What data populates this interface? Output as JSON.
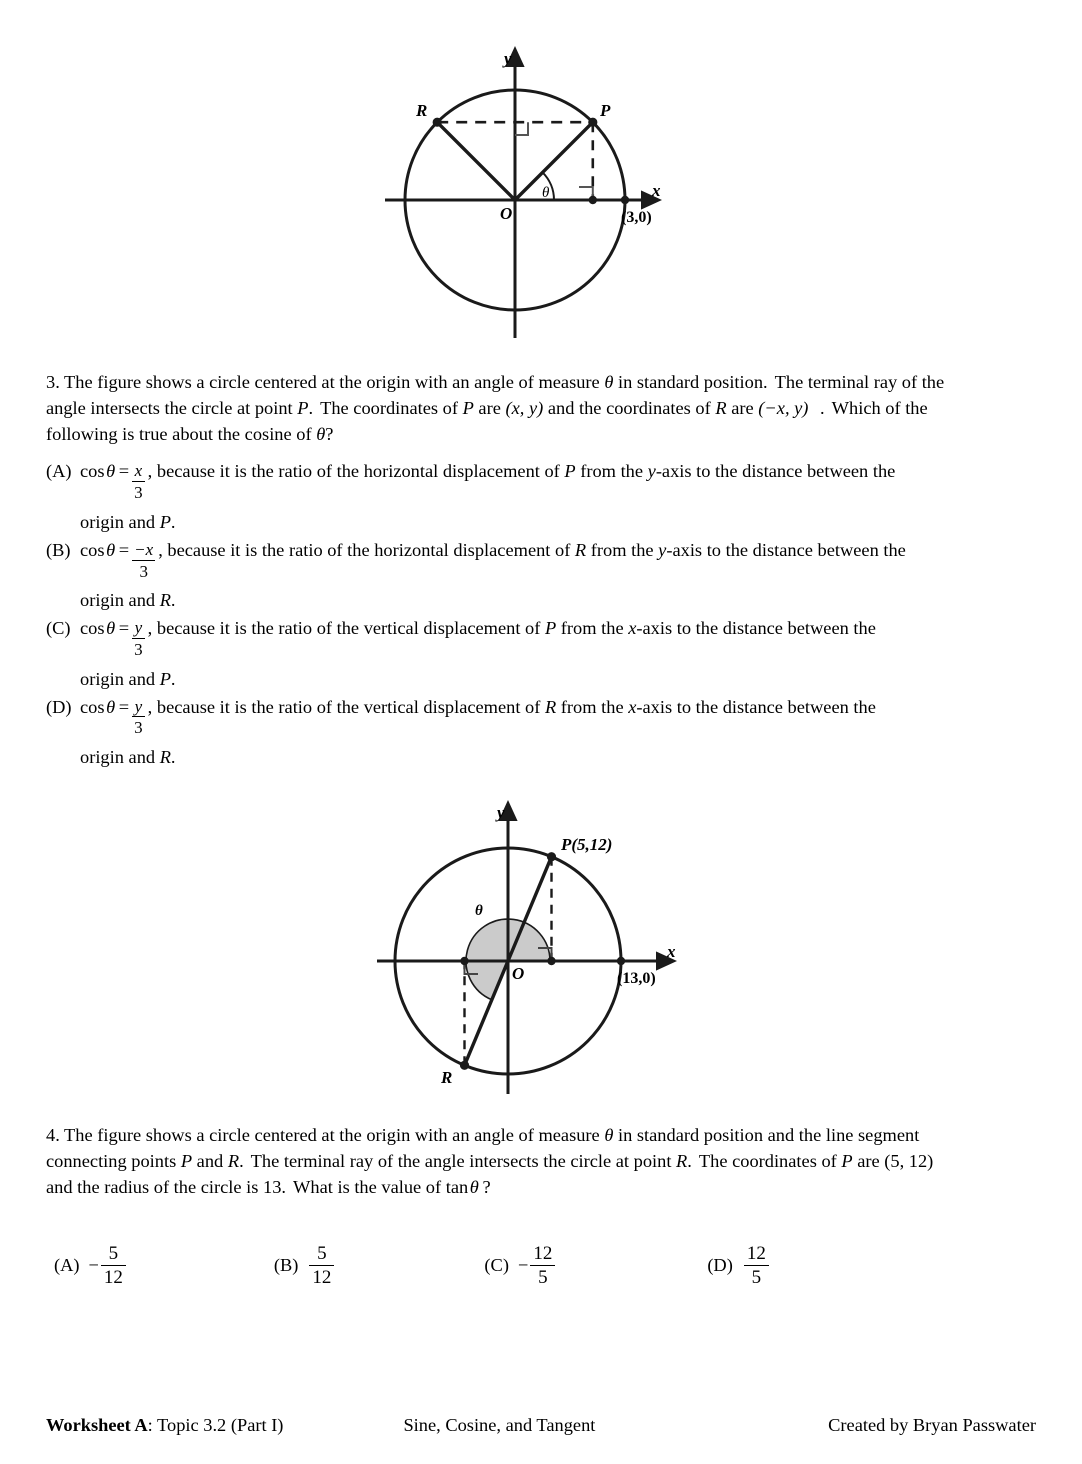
{
  "document": {
    "kind": "math-worksheet-page"
  },
  "figure1": {
    "name": "unit-circle-with-P-and-R-reflection",
    "axis_x_label": "x",
    "axis_y_label": "y",
    "origin_label": "O",
    "point_p_label": "P",
    "point_r_label": "R",
    "angle_label": "θ",
    "x_intercept_label": "(3,0)",
    "radius": 3
  },
  "question3": {
    "number": "3.",
    "lines": [
      "3. The figure shows a circle centered at the origin with an angle of measure θ in standard position.  The terminal ray of the",
      "angle intersects the circle at point P.  The coordinates of P are (x, y) and the coordinates of R are (−x, y)  .  Which of the",
      "following is true about the cosine of θ?"
    ],
    "choices": [
      {
        "label": "(A)",
        "expr_lead": "cos θ =",
        "numerator": "x",
        "denominator": "3",
        "reason": ", because it is the ratio of the horizontal displacement of P from the y-axis to the distance between the",
        "continuation": "origin and P."
      },
      {
        "label": "(B)",
        "expr_lead": "cos θ =",
        "numerator": "−x",
        "denominator": "3",
        "reason": ", because it is the ratio of the horizontal displacement of R from the y-axis to the distance between the",
        "continuation": "origin and R."
      },
      {
        "label": "(C)",
        "expr_lead": "cos θ =",
        "numerator": "y",
        "denominator": "3",
        "reason": ", because it is the ratio of the vertical displacement of P from the x-axis to the distance between the",
        "continuation": "origin and P."
      },
      {
        "label": "(D)",
        "expr_lead": "cos θ =",
        "numerator": "y",
        "denominator": "3",
        "reason": ", because it is the ratio of the vertical displacement of R from the x-axis to the distance between the",
        "continuation": "origin and R."
      }
    ]
  },
  "figure2": {
    "name": "circle-radius-13-with-P-5-12-and-R",
    "axis_x_label": "x",
    "axis_y_label": "y",
    "origin_label": "O",
    "point_p_label": "P(5,12)",
    "point_r_label": "R",
    "angle_label": "θ",
    "x_intercept_label": "(13,0)",
    "radius": 13,
    "sector_fill": "#cccccc"
  },
  "question4": {
    "number": "4.",
    "lines": [
      "4. The figure shows a circle centered at the origin with an angle of measure θ in standard position and the line segment",
      "connecting points P and R.  The terminal ray of the angle intersects the circle at point R.  The coordinates of P are (5, 12)",
      "and the radius of the circle is 13.  What is the value of tan θ?"
    ],
    "choices": [
      {
        "label": "(A)",
        "sign": "−",
        "numerator": "5",
        "denominator": "12"
      },
      {
        "label": "(B)",
        "sign": "",
        "numerator": "5",
        "denominator": "12"
      },
      {
        "label": "(C)",
        "sign": "−",
        "numerator": "12",
        "denominator": "5"
      },
      {
        "label": "(D)",
        "sign": "",
        "numerator": "12",
        "denominator": "5"
      }
    ]
  },
  "footer": {
    "left_bold": "Worksheet A",
    "left_rest": ": Topic 3.2 (Part I)",
    "center": "Sine, Cosine, and Tangent",
    "right": "Created by Bryan Passwater"
  }
}
